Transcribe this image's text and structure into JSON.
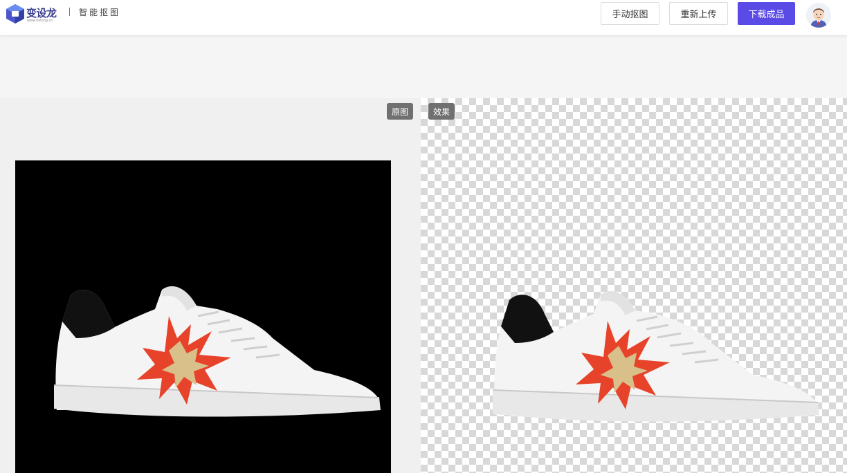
{
  "header": {
    "brand_name": "变设龙",
    "brand_url": "www.bslong.cn",
    "page_title": "智能抠图",
    "buttons": {
      "manual_cutout": "手动抠图",
      "reupload": "重新上传",
      "download": "下载成品"
    },
    "accent_color": "#5b4be6"
  },
  "workspace": {
    "original_tag": "原图",
    "result_tag": "效果",
    "transparency_pattern": "checkerboard"
  },
  "icons": [
    "logo-icon",
    "avatar-icon"
  ]
}
